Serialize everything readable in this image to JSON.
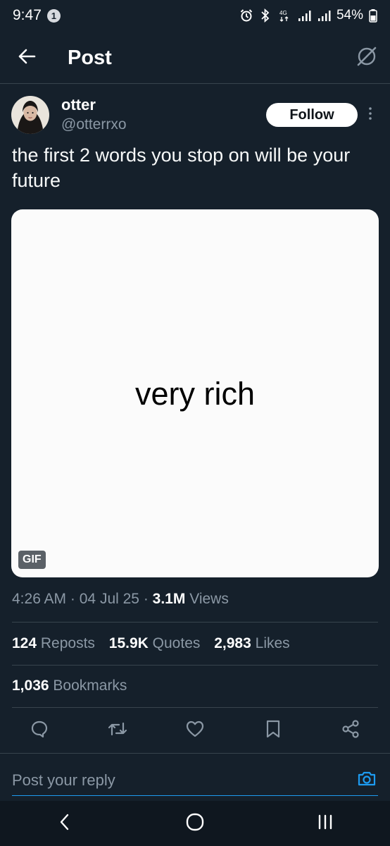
{
  "status_bar": {
    "time": "9:47",
    "notification_count": "1",
    "battery": "54%"
  },
  "header": {
    "title": "Post"
  },
  "post": {
    "author_name": "otter",
    "author_handle": "@otterrxo",
    "follow_label": "Follow",
    "text": "the first 2 words you stop on will be your future",
    "media_text": "very rich",
    "media_badge": "GIF",
    "meta": {
      "time": "4:26 AM",
      "date": "04 Jul 25",
      "views_count": "3.1M",
      "views_label": "Views",
      "separator": "·"
    },
    "stats": {
      "reposts_count": "124",
      "reposts_label": "Reposts",
      "quotes_count": "15.9K",
      "quotes_label": "Quotes",
      "likes_count": "2,983",
      "likes_label": "Likes",
      "bookmarks_count": "1,036",
      "bookmarks_label": "Bookmarks"
    }
  },
  "reply": {
    "placeholder": "Post your reply"
  },
  "icons": {
    "back": "arrow-left-icon",
    "header_right": "grok-icon",
    "more": "more-vertical-icon",
    "reply": "comment-icon",
    "repost": "repost-icon",
    "like": "heart-icon",
    "bookmark": "bookmark-icon",
    "share": "share-icon",
    "camera": "camera-icon"
  },
  "colors": {
    "background": "#15202b",
    "accent": "#1d9bf0",
    "muted": "#8b98a5",
    "divider": "#38444d"
  }
}
